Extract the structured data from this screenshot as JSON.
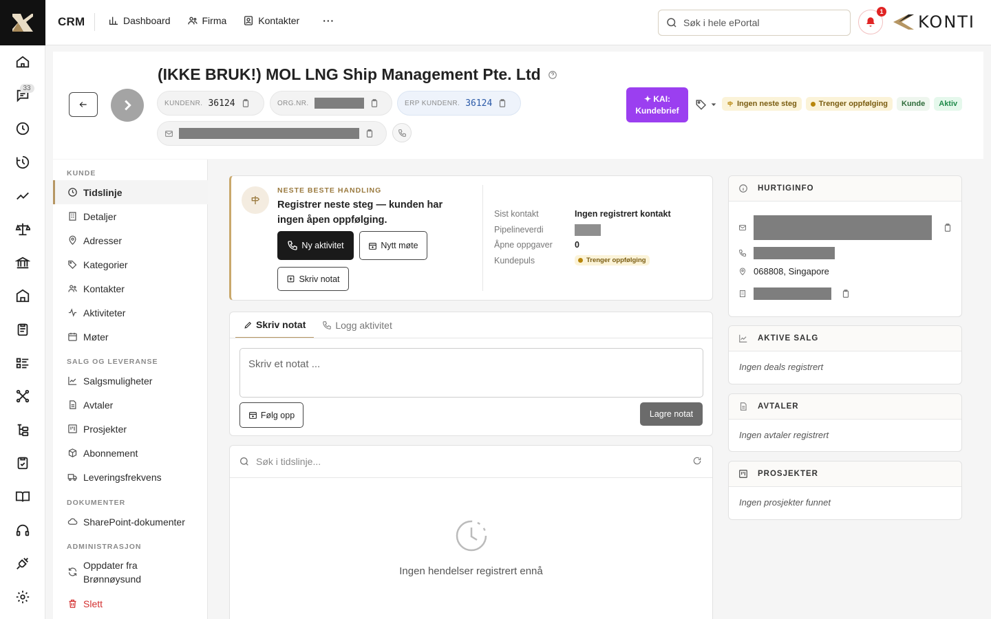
{
  "topbar": {
    "app_name": "CRM",
    "nav": [
      "Dashboard",
      "Firma",
      "Kontakter"
    ],
    "more": "···",
    "search_placeholder": "Søk i hele ePortal",
    "notification_count": "1",
    "brand": "KONTI"
  },
  "rail": {
    "messages_badge": "33"
  },
  "company": {
    "title": "(IKKE BRUK!) MOL LNG Ship Management Pte. Ltd",
    "kundenr_label": "KUNDENR.",
    "kundenr": "36124",
    "orgnr_label": "ORG.NR.",
    "erp_label": "ERP KUNDENR.",
    "erp": "36124",
    "kai_line1": "KAI:",
    "kai_line2": "Kundebrief",
    "badges": [
      "Ingen neste steg",
      "Trenger oppfølging",
      "Kunde",
      "Aktiv"
    ]
  },
  "sidebar": {
    "sections": [
      "KUNDE",
      "SALG OG LEVERANSE",
      "DOKUMENTER",
      "ADMINISTRASJON"
    ],
    "kunde": [
      "Tidslinje",
      "Detaljer",
      "Adresser",
      "Kategorier",
      "Kontakter",
      "Aktiviteter",
      "Møter"
    ],
    "salg": [
      "Salgsmuligheter",
      "Avtaler",
      "Prosjekter",
      "Abonnement",
      "Leveringsfrekvens"
    ],
    "dokumenter": [
      "SharePoint-dokumenter"
    ],
    "admin_update_1": "Oppdater fra",
    "admin_update_2": "Brønnøysund",
    "admin_delete": "Slett"
  },
  "nba": {
    "label": "NESTE BESTE HANDLING",
    "text": "Registrer neste steg — kunden har ingen åpen oppfølging.",
    "btn_new_activity": "Ny aktivitet",
    "btn_new_meeting": "Nytt møte",
    "btn_write_note": "Skriv notat",
    "facts": [
      {
        "label": "Sist kontakt",
        "value": "Ingen registrert kontakt"
      },
      {
        "label": "Pipelineverdi",
        "value": ""
      },
      {
        "label": "Åpne oppgaver",
        "value": "0"
      },
      {
        "label": "Kundepuls",
        "value": "Trenger oppfølging"
      }
    ]
  },
  "note": {
    "tab_write": "Skriv notat",
    "tab_log": "Logg aktivitet",
    "placeholder": "Skriv et notat ...",
    "follow_up": "Følg opp",
    "save": "Lagre notat"
  },
  "timeline": {
    "search_placeholder": "Søk i tidslinje...",
    "empty": "Ingen hendelser registrert ennå"
  },
  "panels": {
    "quickinfo_title": "HURTIGINFO",
    "address": "068808, Singapore",
    "sales_title": "AKTIVE SALG",
    "sales_empty": "Ingen deals registrert",
    "agreements_title": "AVTALER",
    "agreements_empty": "Ingen avtaler registrert",
    "projects_title": "PROSJEKTER",
    "projects_empty": "Ingen prosjekter funnet"
  }
}
